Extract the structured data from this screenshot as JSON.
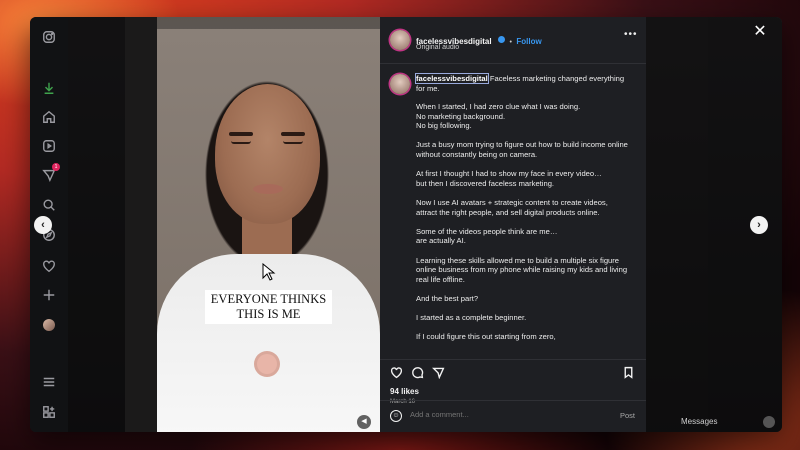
{
  "post": {
    "username": "facelessvibesdigital",
    "follow_label": "Follow",
    "separator": "•",
    "audio": "Original audio",
    "caption_username": "facelessvibesdigital",
    "caption_first": " Faceless marketing changed everything for me.",
    "caption_body": "When I started, I had zero clue what I was doing.\nNo marketing background.\nNo big following.\n\nJust a busy mom trying to figure out how to build income online without constantly being on camera.\n\nAt first I thought I had to show my face in every video…\nbut then I discovered faceless marketing.\n\nNow I use AI avatars + strategic content to create videos, attract the right people, and sell digital products online.\n\nSome of the videos people think are me…\nare actually AI.\n\nLearning these skills allowed me to build a multiple six figure online business from my phone while raising my kids and living real life offline.\n\nAnd the best part?\n\nI started as a complete beginner.\n\nIf I could figure this out starting from zero,",
    "likes": "94 likes",
    "date": "March 16",
    "comment_placeholder": "Add a comment...",
    "post_label": "Post"
  },
  "media": {
    "overlay_line1": "EVERYONE THINKS",
    "overlay_line2": "THIS IS ME"
  },
  "background": {
    "messages_label": "Messages"
  },
  "sidebar": {
    "notification_count": "1"
  },
  "colors": {
    "accent": "#3897f0",
    "panel_bg": "#1e1f23",
    "notification": "#e0245e"
  }
}
